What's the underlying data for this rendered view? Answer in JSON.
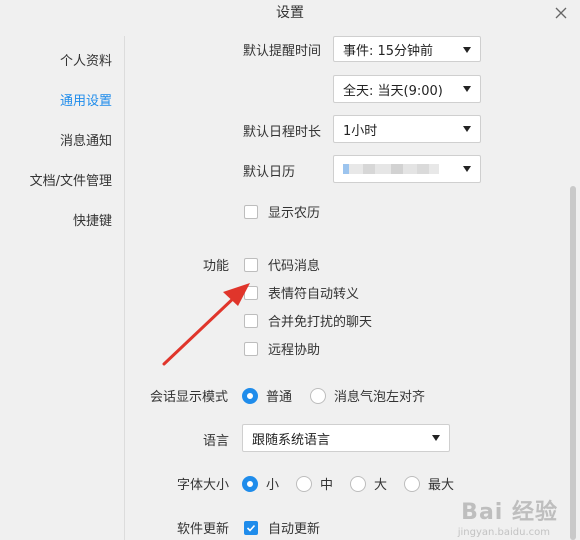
{
  "window": {
    "title": "设置"
  },
  "sidebar": {
    "items": [
      {
        "label": "个人资料",
        "active": false
      },
      {
        "label": "通用设置",
        "active": true
      },
      {
        "label": "消息通知",
        "active": false
      },
      {
        "label": "文档/文件管理",
        "active": false
      },
      {
        "label": "快捷键",
        "active": false
      }
    ]
  },
  "calendar": {
    "reminder_label": "默认提醒时间",
    "reminder_event": "事件: 15分钟前",
    "reminder_allday": "全天: 当天(9:00)",
    "duration_label": "默认日程时长",
    "duration_value": "1小时",
    "default_calendar_label": "默认日历",
    "lunar_label": "显示农历",
    "lunar_checked": false
  },
  "features": {
    "label": "功能",
    "items": [
      {
        "label": "代码消息",
        "checked": false
      },
      {
        "label": "表情符自动转义",
        "checked": false
      },
      {
        "label": "合并免打扰的聊天",
        "checked": false
      },
      {
        "label": "远程协助",
        "checked": false
      }
    ]
  },
  "display_mode": {
    "label": "会话显示模式",
    "options": [
      {
        "label": "普通",
        "selected": true
      },
      {
        "label": "消息气泡左对齐",
        "selected": false
      }
    ]
  },
  "language": {
    "label": "语言",
    "value": "跟随系统语言"
  },
  "font_size": {
    "label": "字体大小",
    "options": [
      {
        "label": "小",
        "selected": true
      },
      {
        "label": "中",
        "selected": false
      },
      {
        "label": "大",
        "selected": false
      },
      {
        "label": "最大",
        "selected": false
      }
    ]
  },
  "update": {
    "label": "软件更新",
    "auto_label": "自动更新",
    "auto_checked": true
  },
  "watermark": {
    "text": "Bai 经验",
    "sub": "jingyan.baidu.com"
  },
  "colors": {
    "accent": "#1f8ceb",
    "annotation_arrow": "#e0352b"
  }
}
